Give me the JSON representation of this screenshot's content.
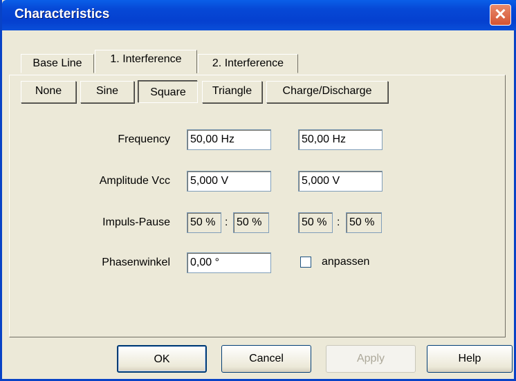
{
  "window": {
    "title": "Characteristics",
    "close_glyph": "✕"
  },
  "tabs": [
    {
      "label": "Base Line",
      "active": false
    },
    {
      "label": "1. Interference",
      "active": true
    },
    {
      "label": "2. Interference",
      "active": false
    }
  ],
  "waveforms": [
    {
      "label": "None",
      "pressed": false
    },
    {
      "label": "Sine",
      "pressed": false
    },
    {
      "label": "Square",
      "pressed": true
    },
    {
      "label": "Triangle",
      "pressed": false
    },
    {
      "label": "Charge/Discharge",
      "pressed": false
    }
  ],
  "form": {
    "frequency": {
      "label": "Frequency",
      "value1": "50,00 Hz",
      "value2": "50,00 Hz"
    },
    "amplitude": {
      "label": "Amplitude Vcc",
      "value1": "5,000 V",
      "value2": "5,000 V"
    },
    "impuls": {
      "label": "Impuls-Pause",
      "pulse1": "50 %",
      "pause1": "50 %",
      "pulse2": "50 %",
      "pause2": "50 %",
      "separator": ":"
    },
    "phase": {
      "label": "Phasenwinkel",
      "value": "0,00 °"
    },
    "adapt": {
      "label": "anpassen",
      "checked": false
    }
  },
  "buttons": {
    "ok": "OK",
    "cancel": "Cancel",
    "apply": "Apply",
    "help": "Help"
  }
}
